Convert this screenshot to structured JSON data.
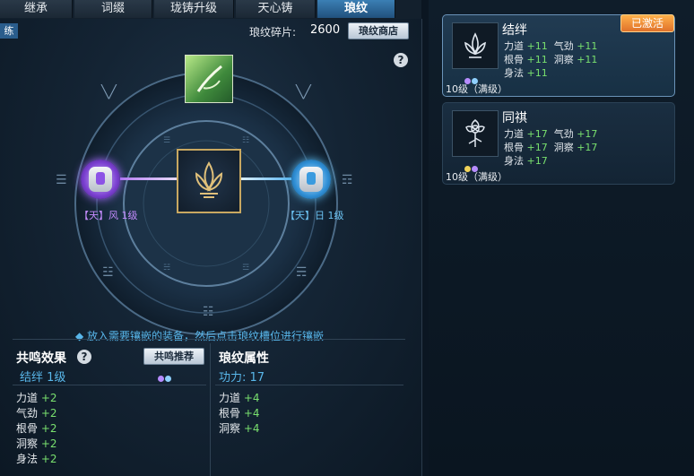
{
  "tabs": [
    {
      "label": "继承"
    },
    {
      "label": "词缀"
    },
    {
      "label": "珑铸升级"
    },
    {
      "label": "天心铸"
    },
    {
      "label": "琅纹",
      "active": true
    }
  ],
  "side_tag": "练",
  "fragments": {
    "label": "琅纹碎片:",
    "value": "2600",
    "shop_label": "琅纹商店"
  },
  "slots": {
    "left": {
      "label": "【天】风 1级",
      "color": "#a65ae8"
    },
    "right": {
      "label": "【天】日 1级",
      "color": "#4aa8e6"
    }
  },
  "hint": "◆ 放入需要镶嵌的装备，然后点击琅纹槽位进行镶嵌",
  "resonance": {
    "title": "共鸣效果",
    "recommend_label": "共鸣推荐",
    "current": "结绊  1级",
    "attrs": [
      {
        "name": "力道",
        "value": "+2"
      },
      {
        "name": "气劲",
        "value": "+2"
      },
      {
        "name": "根骨",
        "value": "+2"
      },
      {
        "name": "洞察",
        "value": "+2"
      },
      {
        "name": "身法",
        "value": "+2"
      }
    ]
  },
  "props": {
    "title": "琅纹属性",
    "power": "功力: 17",
    "attrs": [
      {
        "name": "力道",
        "value": "+4"
      },
      {
        "name": "根骨",
        "value": "+4"
      },
      {
        "name": "洞察",
        "value": "+4"
      }
    ]
  },
  "cards": [
    {
      "name": "结绊",
      "badge": "已激活",
      "rows": [
        [
          {
            "name": "力道",
            "value": "+11"
          },
          {
            "name": "气劲",
            "value": "+11"
          }
        ],
        [
          {
            "name": "根骨",
            "value": "+11"
          },
          {
            "name": "洞察",
            "value": "+11"
          }
        ],
        [
          {
            "name": "身法",
            "value": "+11"
          }
        ]
      ],
      "level": "10级（满级）",
      "dots": [
        "#b68cff",
        "#8fd0ff"
      ]
    },
    {
      "name": "同祺",
      "rows": [
        [
          {
            "name": "力道",
            "value": "+17"
          },
          {
            "name": "气劲",
            "value": "+17"
          }
        ],
        [
          {
            "name": "根骨",
            "value": "+17"
          },
          {
            "name": "洞察",
            "value": "+17"
          }
        ],
        [
          {
            "name": "身法",
            "value": "+17"
          }
        ]
      ],
      "level": "10级（满级）",
      "dots": [
        "#f0d35a",
        "#b68cff"
      ]
    }
  ],
  "colors": {
    "accent": "#59b7ea",
    "positive": "#79e06e",
    "badge": "#e0722b",
    "gold": "#c8a861"
  }
}
